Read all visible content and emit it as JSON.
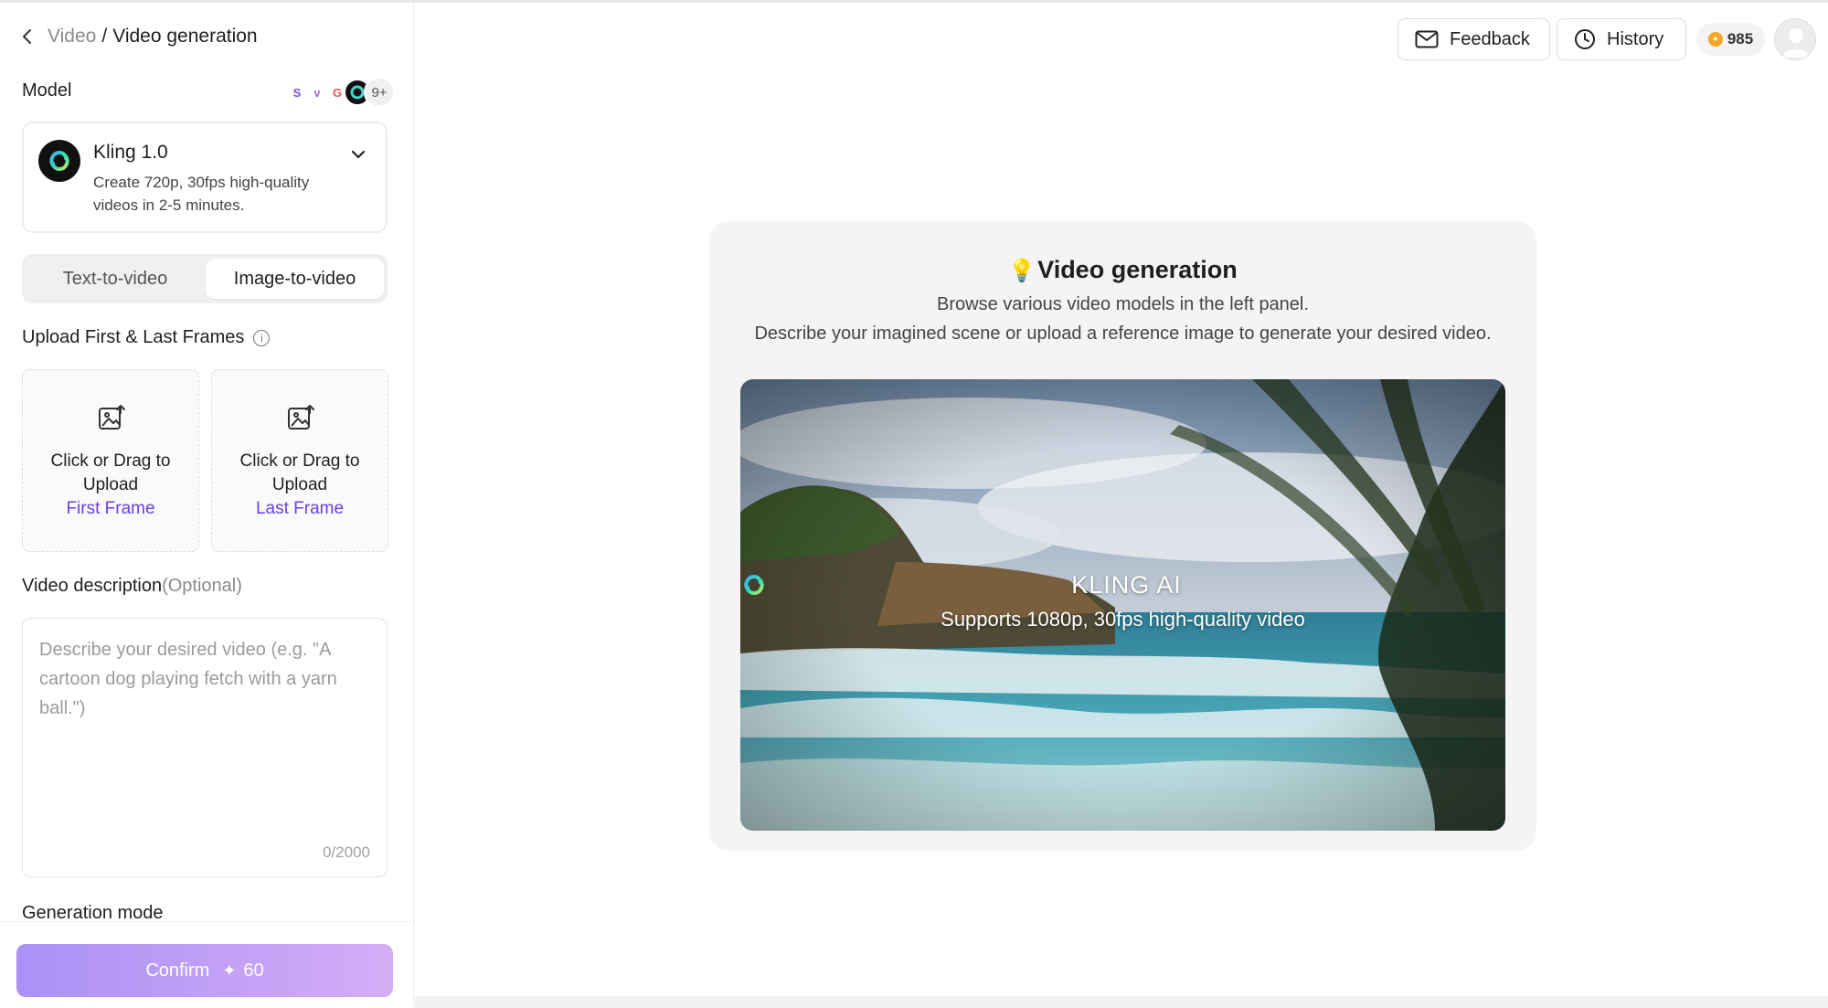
{
  "breadcrumb": {
    "parent": "Video",
    "separator": "/",
    "current": "Video generation"
  },
  "model_section": {
    "label": "Model",
    "more_count": "9+",
    "selected": {
      "name": "Kling 1.0",
      "description": "Create 720p, 30fps high-quality videos in 2-5 minutes."
    }
  },
  "mode_tabs": {
    "text_to_video": "Text-to-video",
    "image_to_video": "Image-to-video",
    "active": "Image-to-video"
  },
  "upload": {
    "label": "Upload First & Last Frames",
    "first": {
      "text": "Click or Drag to Upload",
      "kind": "First Frame"
    },
    "last": {
      "text": "Click or Drag to Upload",
      "kind": "Last Frame"
    }
  },
  "description": {
    "label": "Video description",
    "optional": "(Optional)",
    "placeholder": "Describe your desired video (e.g. \"A cartoon dog playing fetch with a yarn ball.\")",
    "counter": "0/2000"
  },
  "generation_mode": {
    "label": "Generation mode"
  },
  "confirm": {
    "label": "Confirm",
    "cost": "60"
  },
  "header": {
    "feedback": "Feedback",
    "history": "History",
    "credits": "985"
  },
  "center": {
    "title": "Video generation",
    "line1": "Browse various video models in the left panel.",
    "line2": "Describe your imagined scene or upload a reference image to generate your desired video.",
    "hero_brand": "KLING AI",
    "hero_tagline": "Supports 1080p, 30fps high-quality video"
  },
  "colors": {
    "accent": "#6a3fe0",
    "confirm_start": "#a68bf5",
    "confirm_end": "#d3a9f6",
    "coin": "#f3a623"
  }
}
